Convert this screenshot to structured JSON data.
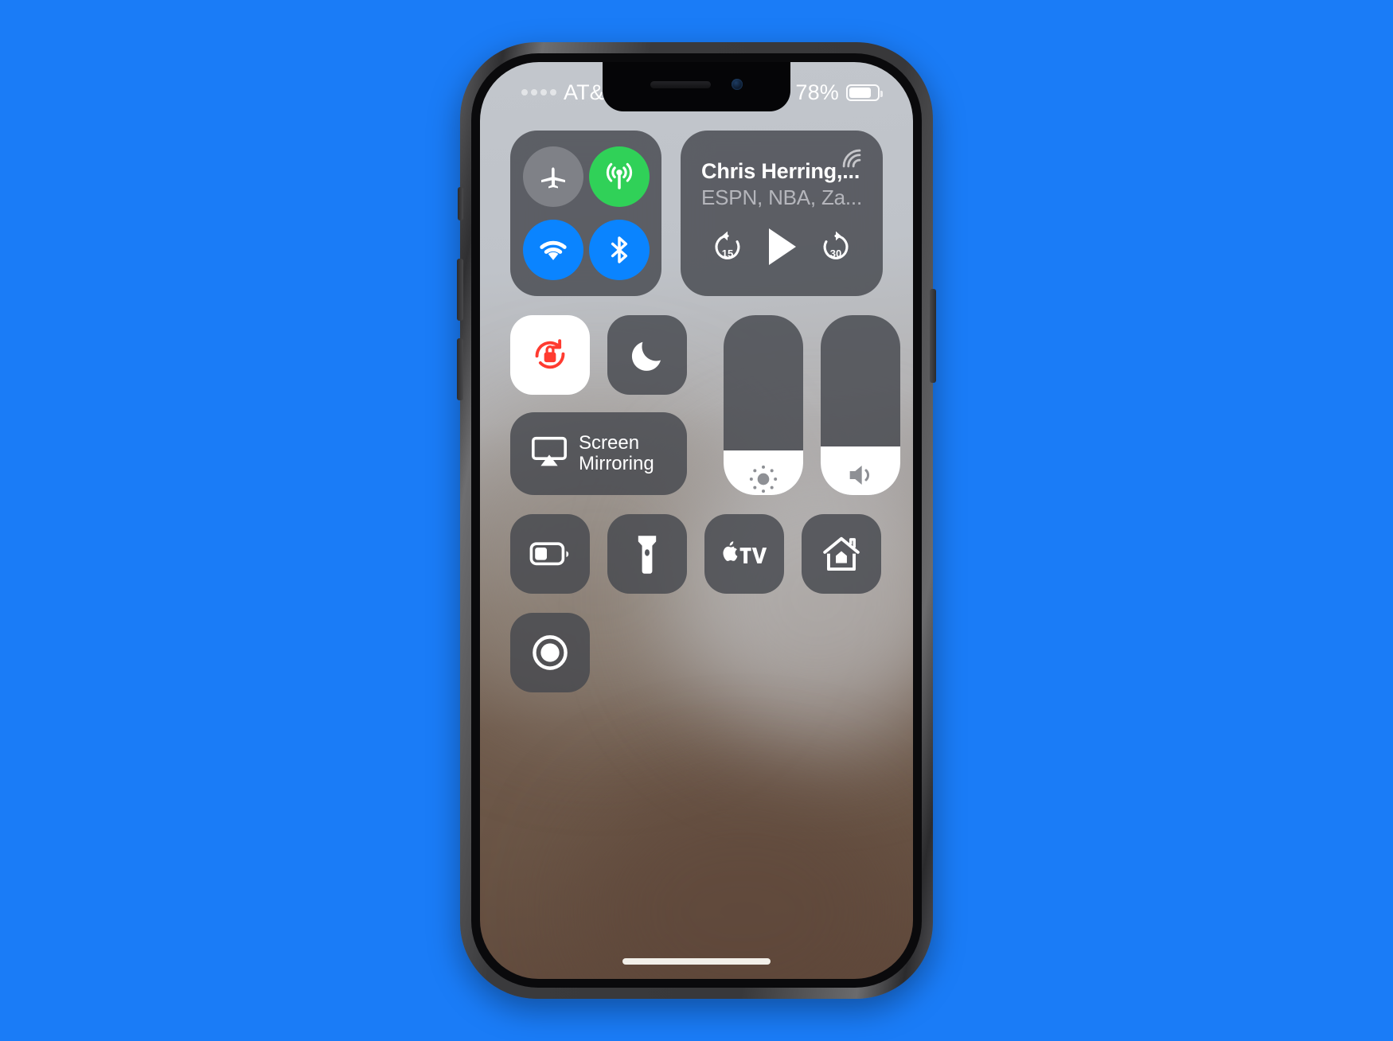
{
  "background": {
    "color": "#1a7cf7"
  },
  "device": {
    "name": "iPhone X",
    "frame_color": "#3a3a3c"
  },
  "status_bar": {
    "carrier": "AT&T Wi-Fi",
    "signal_dots": 4,
    "wifi_icon": "wifi-icon",
    "rotation_lock_icon": "rotation-lock-icon",
    "location_icon": "location-arrow-icon",
    "battery_percent": "78%",
    "battery_level": 78,
    "battery_icon": "battery-icon"
  },
  "control_center": {
    "connectivity": {
      "toggles": [
        {
          "name": "airplane-mode",
          "label": "Airplane Mode",
          "icon": "airplane-icon",
          "state": "off",
          "color": "#82848a"
        },
        {
          "name": "cellular-data",
          "label": "Cellular Data",
          "icon": "cellular-icon",
          "state": "on",
          "color": "#30d158"
        },
        {
          "name": "wifi",
          "label": "Wi-Fi",
          "icon": "wifi-icon",
          "state": "on",
          "color": "#0a84ff"
        },
        {
          "name": "bluetooth",
          "label": "Bluetooth",
          "icon": "bluetooth-icon",
          "state": "on",
          "color": "#0a84ff"
        }
      ]
    },
    "media": {
      "title": "Chris Herring,...",
      "subtitle": "ESPN, NBA, Za...",
      "airplay_icon": "airplay-audio-icon",
      "skip_back_label": "15",
      "skip_forward_label": "30",
      "play_icon": "play-icon",
      "playback_state": "paused"
    },
    "orientation_lock": {
      "label": "Orientation Lock",
      "icon": "rotation-lock-icon",
      "state": "on",
      "accent": "#ff3b30"
    },
    "do_not_disturb": {
      "label": "Do Not Disturb",
      "icon": "moon-icon",
      "state": "off"
    },
    "screen_mirroring": {
      "label_line1": "Screen",
      "label_line2": "Mirroring",
      "icon": "airplay-video-icon"
    },
    "brightness": {
      "label": "Brightness",
      "icon": "brightness-icon",
      "value": 25
    },
    "volume": {
      "label": "Volume",
      "icon": "speaker-icon",
      "value": 27
    },
    "shortcuts": [
      {
        "name": "low-power-mode",
        "label": "Low Power Mode",
        "icon": "battery-icon"
      },
      {
        "name": "flashlight",
        "label": "Flashlight",
        "icon": "flashlight-icon"
      },
      {
        "name": "apple-tv-remote",
        "label": "Apple TV Remote",
        "icon": "apple-tv-icon"
      },
      {
        "name": "home",
        "label": "Home",
        "icon": "home-icon"
      }
    ],
    "screen_recording": {
      "label": "Screen Recording",
      "icon": "record-icon"
    }
  },
  "home_indicator": {
    "name": "home-indicator"
  }
}
